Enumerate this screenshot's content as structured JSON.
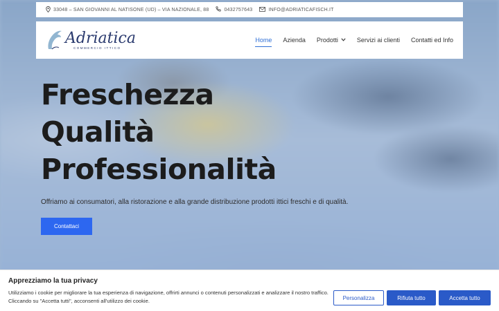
{
  "topbar": {
    "address": "33048 – SAN GIOVANNI AL NATISONE (UD) – VIA NAZIONALE, 88",
    "phone": "0432757643",
    "email": "INFO@ADRIATICAFISCH.IT",
    "icons": [
      "map-pin-icon",
      "phone-icon",
      "mail-icon"
    ]
  },
  "header": {
    "logo_name": "Adriatica",
    "logo_sub": "COMMERCIO ITTICO",
    "nav": [
      {
        "label": "Home",
        "active": true
      },
      {
        "label": "Azienda"
      },
      {
        "label": "Prodotti",
        "icon": "chevron-down-icon"
      },
      {
        "label": "Servizi ai clienti"
      },
      {
        "label": "Contatti ed Info"
      }
    ]
  },
  "hero": {
    "title_lines": [
      "Freschezza",
      "Qualità",
      "Professionalità"
    ],
    "subtitle": "Offriamo ai consumatori, alla ristorazione e alla grande distribuzione prodotti ittici freschi e di qualità.",
    "button": "Contattaci"
  },
  "cookie": {
    "title": "Apprezziamo la tua privacy",
    "text": "Utilizziamo i cookie per migliorare la tua esperienza di navigazione, offrirti annunci o contenuti personalizzati e analizzare il nostro traffico. Cliccando su \"Accetta tutti\", acconsenti all'utilizzo dei cookie.",
    "customize": "Personalizza",
    "reject": "Rifiuta tutto",
    "accept": "Accetta tutto"
  },
  "colors": {
    "accent": "#2d67f0",
    "nav_active": "#2f6fd6",
    "logo": "#2a3a6e"
  }
}
